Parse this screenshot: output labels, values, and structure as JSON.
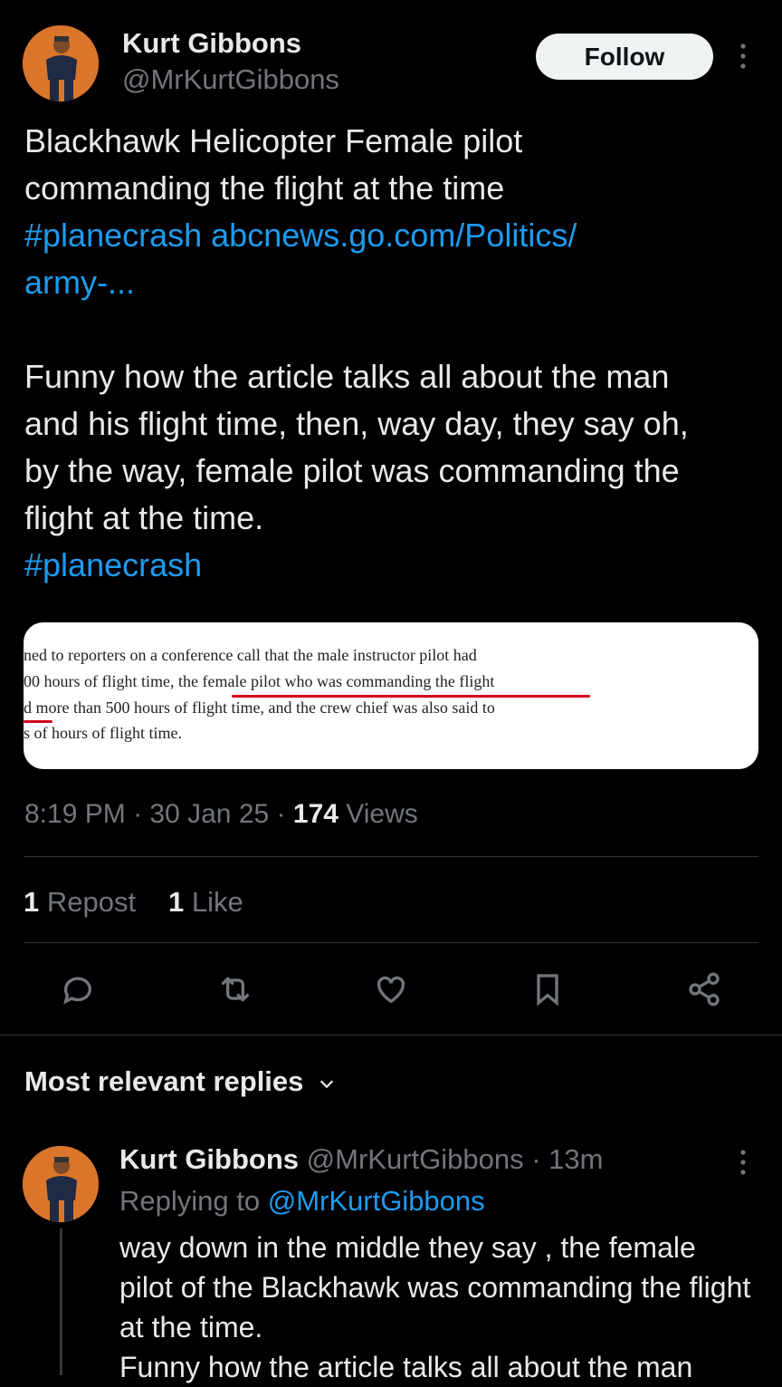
{
  "author": {
    "name": "Kurt Gibbons",
    "handle": "@MrKurtGibbons",
    "follow_label": "Follow"
  },
  "tweet": {
    "line1": "Blackhawk Helicopter Female pilot",
    "line2": "commanding the flight at the time",
    "hashtag1": "#planecrash",
    "url_part1": "abcnews.go.com/Politics/",
    "url_part2": "army-...",
    "para2": "Funny how the article talks all about the man and his flight time, then, way day, they say oh, by the way, female pilot was commanding the flight at the time.",
    "hashtag2": "#planecrash"
  },
  "media": {
    "line1": "ned to reporters on a conference call that the male instructor pilot had",
    "line2a": "00 hours of flight time, the ",
    "line2b": "female pilot who was commanding the flight",
    "line3": "d more than 500 hours of flight time, and the crew chief was also said to",
    "line4": "s of hours of flight time."
  },
  "meta": {
    "time": "8:19 PM",
    "sep": "·",
    "date": "30 Jan 25",
    "views_count": "174",
    "views_label": "Views"
  },
  "stats": {
    "reposts_count": "1",
    "reposts_label": "Repost",
    "likes_count": "1",
    "likes_label": "Like"
  },
  "actions": [
    {
      "icon": "reply-icon"
    },
    {
      "icon": "repost-icon"
    },
    {
      "icon": "like-icon"
    },
    {
      "icon": "bookmark-icon"
    },
    {
      "icon": "share-icon"
    }
  ],
  "replies": {
    "sort_label": "Most relevant replies"
  },
  "reply": {
    "name": "Kurt Gibbons",
    "handle": "@MrKurtGibbons",
    "time": "· 13m",
    "replying_prefix": "Replying to",
    "replying_handle": "@MrKurtGibbons",
    "text1": "way down in the middle they say , the female pilot of the Blackhawk was commanding the flight at the time.",
    "text2": "Funny how the article talks all about the man"
  },
  "colors": {
    "background": "#000000",
    "link": "#1d9bf0",
    "muted": "#71767b",
    "underline": "#d0021b"
  }
}
